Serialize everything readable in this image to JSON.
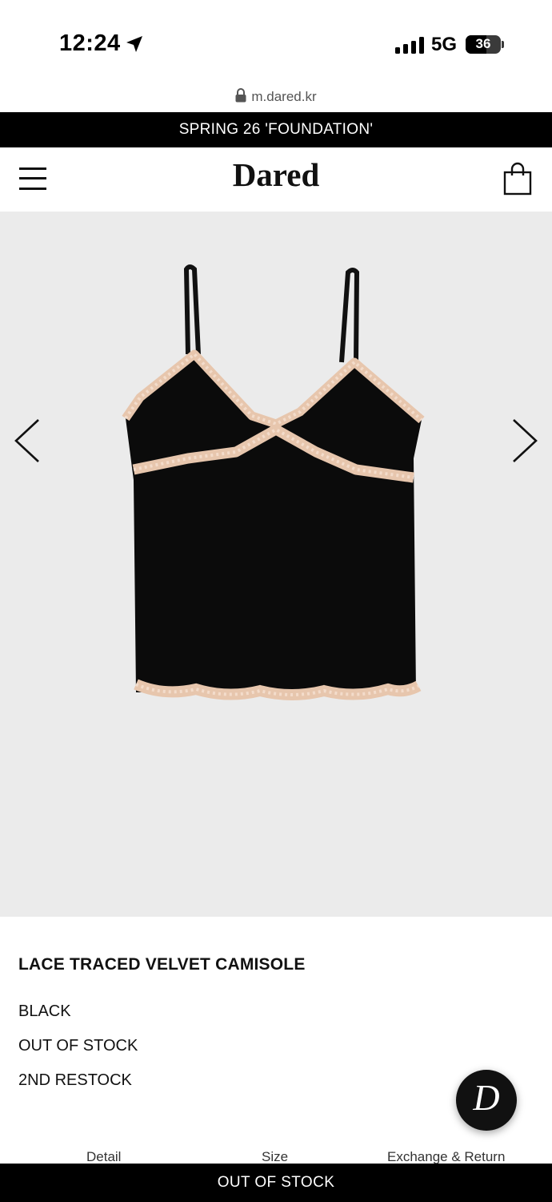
{
  "status_bar": {
    "time": "12:24",
    "network": "5G",
    "battery": "36"
  },
  "browser": {
    "url": "m.dared.kr"
  },
  "announcement": {
    "text": "SPRING 26 'FOUNDATION'"
  },
  "header": {
    "brand": "Dared"
  },
  "product": {
    "name": "LACE TRACED VELVET CAMISOLE",
    "color": "BLACK",
    "stock_status": "OUT OF STOCK",
    "restock_note": "2ND RESTOCK"
  },
  "chat": {
    "letter": "D"
  },
  "tabs": {
    "detail": "Detail",
    "size": "Size",
    "exchange": "Exchange & Return"
  },
  "cta": {
    "label": "OUT OF STOCK"
  },
  "colors": {
    "brand_black": "#000000",
    "gallery_bg": "#ebebeb",
    "lace": "#e9c9b0"
  }
}
